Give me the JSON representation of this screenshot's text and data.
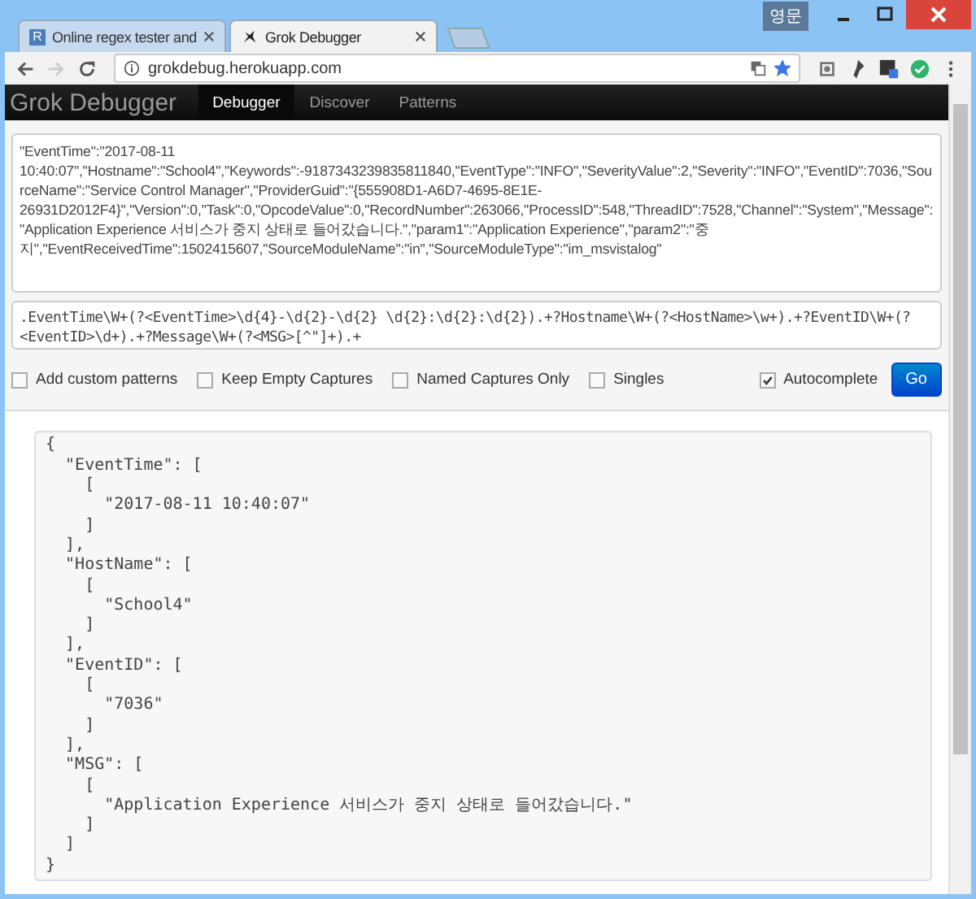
{
  "browser": {
    "ime_indicator": "영문",
    "tabs": [
      {
        "favicon_letter": "R",
        "title": "Online regex tester and",
        "selected": false
      },
      {
        "title": "Grok Debugger",
        "selected": true
      }
    ],
    "address": "grokdebug.herokuapp.com",
    "forward_disabled": true,
    "bookmarked": true
  },
  "navbar": {
    "brand": "Grok Debugger",
    "items": [
      {
        "label": "Debugger",
        "selected": true
      },
      {
        "label": "Discover",
        "selected": false
      },
      {
        "label": "Patterns",
        "selected": false
      }
    ]
  },
  "input_text": "\"EventTime\":\"2017-08-11 10:40:07\",\"Hostname\":\"School4\",\"Keywords\":-9187343239835811840,\"EventType\":\"INFO\",\"SeverityValue\":2,\"Severity\":\"INFO\",\"EventID\":7036,\"SourceName\":\"Service Control Manager\",\"ProviderGuid\":\"{555908D1-A6D7-4695-8E1E-26931D2012F4}\",\"Version\":0,\"Task\":0,\"OpcodeValue\":0,\"RecordNumber\":263066,\"ProcessID\":548,\"ThreadID\":7528,\"Channel\":\"System\",\"Message\":\"Application Experience 서비스가 중지 상태로 들어갔습니다.\",\"param1\":\"Application Experience\",\"param2\":\"중지\",\"EventReceivedTime\":1502415607,\"SourceModuleName\":\"in\",\"SourceModuleType\":\"im_msvistalog\"",
  "pattern_text": ".EventTime\\W+(?<EventTime>\\d{4}-\\d{2}-\\d{2} \\d{2}:\\d{2}:\\d{2}).+?Hostname\\W+(?<HostName>\\w+).+?EventID\\W+(?<EventID>\\d+).+?Message\\W+(?<MSG>[^\"]+).+",
  "options": [
    {
      "label": "Add custom patterns",
      "checked": false
    },
    {
      "label": "Keep Empty Captures",
      "checked": false
    },
    {
      "label": "Named Captures Only",
      "checked": false
    },
    {
      "label": "Singles",
      "checked": false
    },
    {
      "label": "Autocomplete",
      "checked": true
    }
  ],
  "go_button": "Go",
  "output_lines": [
    "{",
    "  \"EventTime\": [",
    "    [",
    "      \"2017-08-11 10:40:07\"",
    "    ]",
    "  ],",
    "  \"HostName\": [",
    "    [",
    "      \"School4\"",
    "    ]",
    "  ],",
    "  \"EventID\": [",
    "    [",
    "      \"7036\"",
    "    ]",
    "  ],",
    "  \"MSG\": [",
    "    [",
    "      \"Application Experience 서비스가 중지 상태로 들어갔습니다.\"",
    "    ]",
    "  ]",
    "}"
  ]
}
